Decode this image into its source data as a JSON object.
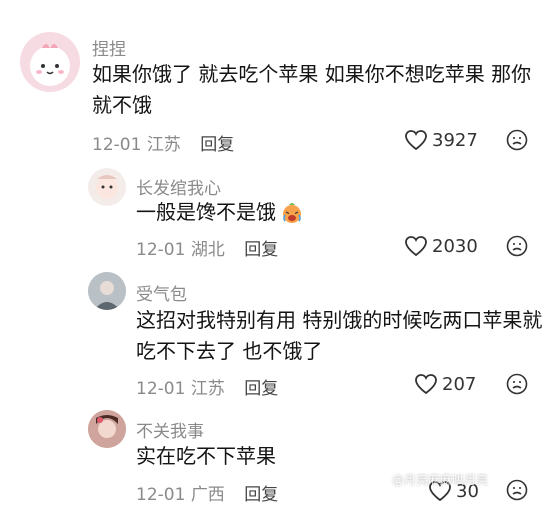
{
  "comment": {
    "author": "捏捏",
    "text_line1": "如果你饿了 就去吃个苹果 如果你不想吃苹果 那你",
    "text_line2": "就不饿",
    "date": "12-01",
    "location": "江苏",
    "reply_label": "回复",
    "likes": "3927"
  },
  "replies": [
    {
      "author": "长发绾我心",
      "text": "一般是馋不是饿",
      "emoji": "crying-emoji",
      "date": "12-01",
      "location": "湖北",
      "reply_label": "回复",
      "likes": "2030"
    },
    {
      "author": "受气包",
      "text_line1": "这招对我特别有用 特别饿的时候吃两口苹果就",
      "text_line2": "吃不下去了 也不饿了",
      "date": "12-01",
      "location": "江苏",
      "reply_label": "回复",
      "likes": "207"
    },
    {
      "author": "不关我事",
      "text": "实在吃不下苹果",
      "date": "12-01",
      "location": "广西",
      "reply_label": "回复",
      "likes": "30"
    }
  ],
  "watermark": "@月亮麻麻哄月亮",
  "icons": {
    "like": "heart-outline-icon",
    "dislike": "unhappy-face-icon"
  }
}
